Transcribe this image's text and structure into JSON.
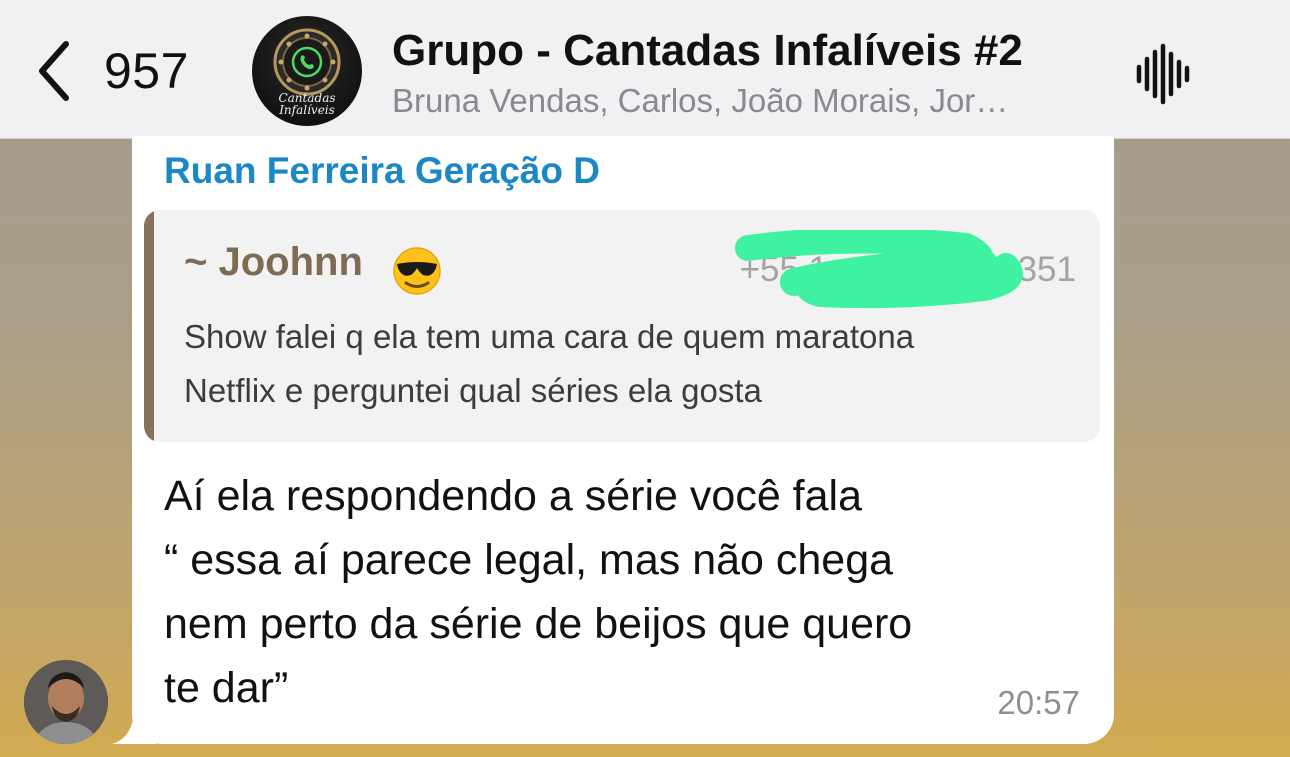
{
  "header": {
    "unread_count": "957",
    "group_avatar_caption": "Cantadas\nInfalíveis",
    "title": "Grupo - Cantadas Infalíveis #2",
    "members": "Bruna Vendas, Carlos, João Morais, Jor…"
  },
  "message": {
    "sender_name": "Ruan Ferreira Geração D",
    "quoted": {
      "author": "~ Joohnn",
      "emoji": "smiling-face-with-sunglasses",
      "phone_partial": "+55 1",
      "phone_suffix": "351",
      "text": "Show falei q ela tem uma cara de quem maratona\nNetflix e perguntei qual séries ela gosta"
    },
    "text": "Aí ela respondendo a série você fala\n“ essa aí parece legal, mas não chega\nnem perto da série de beijos que quero\nte dar”",
    "time": "20:57"
  },
  "colors": {
    "sender_name": "#1c87c5",
    "quote_accent": "#86735b",
    "redaction": "#3ef2a2",
    "header_bg": "#f1f1f3"
  }
}
